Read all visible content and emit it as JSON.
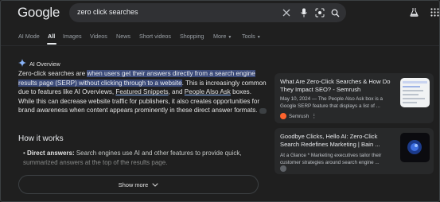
{
  "header": {
    "logo": "Google",
    "search_value": "zero click searches",
    "icons": [
      "close-icon",
      "mic-icon",
      "lens-icon",
      "search-icon",
      "labs-flask-icon",
      "apps-grid-icon"
    ]
  },
  "tabs": [
    {
      "label": "AI Mode"
    },
    {
      "label": "All",
      "active": true
    },
    {
      "label": "Images"
    },
    {
      "label": "Videos"
    },
    {
      "label": "News"
    },
    {
      "label": "Short videos"
    },
    {
      "label": "Shopping"
    },
    {
      "label": "More"
    },
    {
      "label": "Tools"
    }
  ],
  "overview": {
    "heading": "AI Overview",
    "p1_a": "Zero-click searches are ",
    "p1_hl": "when users get their answers directly from a search engine results page (SERP) without clicking through to a website",
    "p1_b": ". This is increasingly common due to features like AI Overviews, ",
    "p1_link1": "Featured Snippets",
    "p1_c": ", and ",
    "p1_link2": "People Also Ask",
    "p1_d": " boxes. While this can decrease website traffic for publishers, it also creates opportunities for brand awareness when content appears prominently in these direct answer formats.",
    "how_heading": "How it works",
    "bullet_label": "Direct answers:",
    "bullet_text": " Search engines use AI and other features to provide quick, summarized answers at the top of the results page.",
    "show_more": "Show more"
  },
  "sources": [
    {
      "title": "What Are Zero-Click Searches & How Do They Impact SEO? - Semrush",
      "snippet": "May 10, 2024 — The People Also Ask box is a Google SERP feature that displays a list of ...",
      "site": "Semrush"
    },
    {
      "title": "Goodbye Clicks, Hello AI: Zero-Click Search Redefines Marketing | Bain ...",
      "snippet": "At a Glance * Marketing executives tailor their customer strategies around search engine ...",
      "site": ""
    }
  ],
  "colors": {
    "background": "#1f1f1f",
    "highlight": "#3b4a79",
    "link_underline": "#8ab4f8",
    "card": "#28292a"
  }
}
